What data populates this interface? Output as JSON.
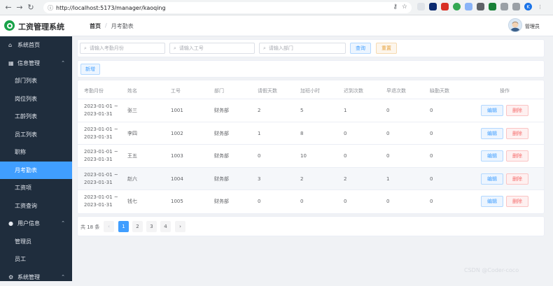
{
  "browser": {
    "url": "http://localhost:5173/manager/kaoqing"
  },
  "header": {
    "app_title": "工资管理系统",
    "breadcrumb_home": "首页",
    "breadcrumb_sep": "/",
    "breadcrumb_current": "月考勤表",
    "user_name": "管理员"
  },
  "sidebar": {
    "items": [
      {
        "label": "系统首页",
        "icon": "home-icon",
        "level": "top"
      },
      {
        "label": "信息管理",
        "icon": "grid-icon",
        "level": "top",
        "expanded": true
      },
      {
        "label": "部门列表",
        "level": "sub"
      },
      {
        "label": "岗位列表",
        "level": "sub"
      },
      {
        "label": "工龄列表",
        "level": "sub"
      },
      {
        "label": "员工列表",
        "level": "sub"
      },
      {
        "label": "职称",
        "level": "sub"
      },
      {
        "label": "月考勤表",
        "level": "sub",
        "active": true
      },
      {
        "label": "工资项",
        "level": "sub"
      },
      {
        "label": "工资查询",
        "level": "sub"
      },
      {
        "label": "用户信息",
        "icon": "user-icon",
        "level": "top",
        "expanded": true
      },
      {
        "label": "管理员",
        "level": "sub"
      },
      {
        "label": "员工",
        "level": "sub"
      },
      {
        "label": "系统管理",
        "icon": "gear-icon",
        "level": "top",
        "expanded": true
      }
    ]
  },
  "search": {
    "month_placeholder": "请输入考勤月份",
    "empno_placeholder": "请输入工号",
    "dept_placeholder": "请输入部门",
    "query_label": "查询",
    "reset_label": "重置"
  },
  "toolbar": {
    "add_label": "新增"
  },
  "table": {
    "headers": [
      "考勤月份",
      "姓名",
      "工号",
      "部门",
      "请假天数",
      "加班小时",
      "迟到次数",
      "早退次数",
      "缺勤天数",
      "操作"
    ],
    "rows": [
      {
        "month_start": "2023-01-01 ~",
        "month_end": "2023-01-31",
        "name": "张三",
        "empno": "1001",
        "dept": "财务部",
        "leave": "2",
        "overtime": "5",
        "late": "1",
        "early": "0",
        "absent": "0"
      },
      {
        "month_start": "2023-01-01 ~",
        "month_end": "2023-01-31",
        "name": "李四",
        "empno": "1002",
        "dept": "财务部",
        "leave": "1",
        "overtime": "8",
        "late": "0",
        "early": "0",
        "absent": "0"
      },
      {
        "month_start": "2023-01-01 ~",
        "month_end": "2023-01-31",
        "name": "王五",
        "empno": "1003",
        "dept": "财务部",
        "leave": "0",
        "overtime": "10",
        "late": "0",
        "early": "0",
        "absent": "0"
      },
      {
        "month_start": "2023-01-01 ~",
        "month_end": "2023-01-31",
        "name": "赵六",
        "empno": "1004",
        "dept": "财务部",
        "leave": "3",
        "overtime": "2",
        "late": "2",
        "early": "1",
        "absent": "0"
      },
      {
        "month_start": "2023-01-01 ~",
        "month_end": "2023-01-31",
        "name": "钱七",
        "empno": "1005",
        "dept": "财务部",
        "leave": "0",
        "overtime": "0",
        "late": "0",
        "early": "0",
        "absent": "0"
      }
    ],
    "edit_label": "编辑",
    "delete_label": "删除"
  },
  "pagination": {
    "total_text": "共 18 条",
    "prev": "‹",
    "next": "›",
    "pages": [
      "1",
      "2",
      "3",
      "4"
    ],
    "current": "1"
  },
  "watermark": "CSDN @Coder-coco"
}
